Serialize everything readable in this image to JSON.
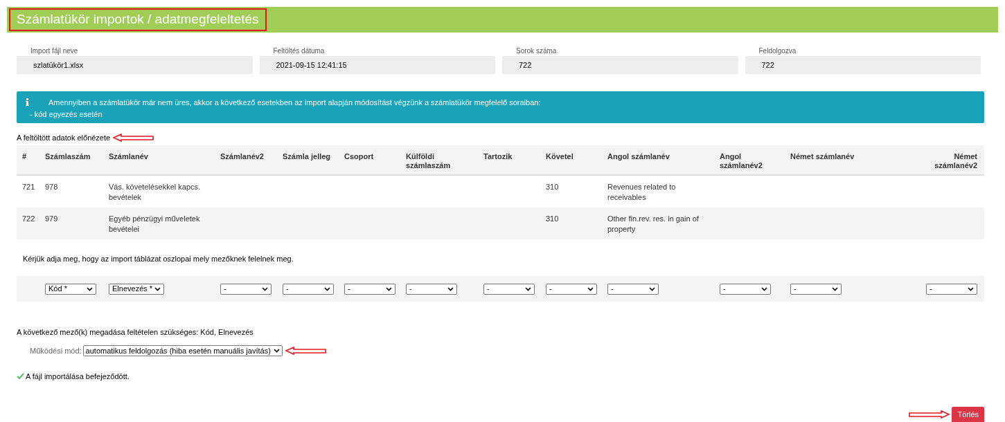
{
  "header": {
    "title": "Számlatükör importok / adatmegfeleltetés"
  },
  "summary": [
    {
      "label": "Import fájl neve",
      "value": "szlatükör1.xlsx"
    },
    {
      "label": "Feltöltés dátuma",
      "value": "2021-09-15 12:41:15"
    },
    {
      "label": "Sorok száma",
      "value": "722"
    },
    {
      "label": "Feldolgozva",
      "value": "722"
    }
  ],
  "info": {
    "line_1": "Amennyiben a számlatükör már nem üres, akkor a következő esetekben az import alapján módosítást végzünk a számlatükör megfelelő soraiban:",
    "line_2": "- kód egyezés esetén"
  },
  "preview_label": "A feltöltött adatok előnézete",
  "table": {
    "columns": [
      "#",
      "Számlaszám",
      "Számlanév",
      "Számlanév2",
      "Számla jelleg",
      "Csoport",
      "Külföldi számlaszám",
      "Tartozik",
      "Követel",
      "Angol számlanév",
      "Angol számlanév2",
      "Német számlanév",
      "Német számlanév2"
    ],
    "rows": [
      [
        "721",
        "978",
        "Vás. követelésekkel kapcs. bevételek",
        "",
        "",
        "",
        "",
        "",
        "310",
        "Revenues related to receivables",
        "",
        "",
        ""
      ],
      [
        "722",
        "979",
        "Egyéb pénzügyi műveletek bevételei",
        "",
        "",
        "",
        "",
        "",
        "310",
        "Other fin.rev. res. in gain of property",
        "",
        "",
        ""
      ]
    ]
  },
  "mapping_instruction": "Kérjük adja meg, hogy az import táblázat oszlopai mely mezőknek felelnek meg.",
  "mapping": [
    "Kód *",
    "Elnevezés *",
    "-",
    "-",
    "-",
    "-",
    "-",
    "-",
    "-",
    "-",
    "-",
    "-"
  ],
  "required_note": "A következő mező(k) megadása feltételen szükséges: Kód, Elnevezés",
  "mode": {
    "label": "Működési mód:",
    "value": "automatikus feldolgozás (hiba esetén manuális javítás)"
  },
  "status": "A fájl importálása befejeződött.",
  "delete_button": "Törlés"
}
